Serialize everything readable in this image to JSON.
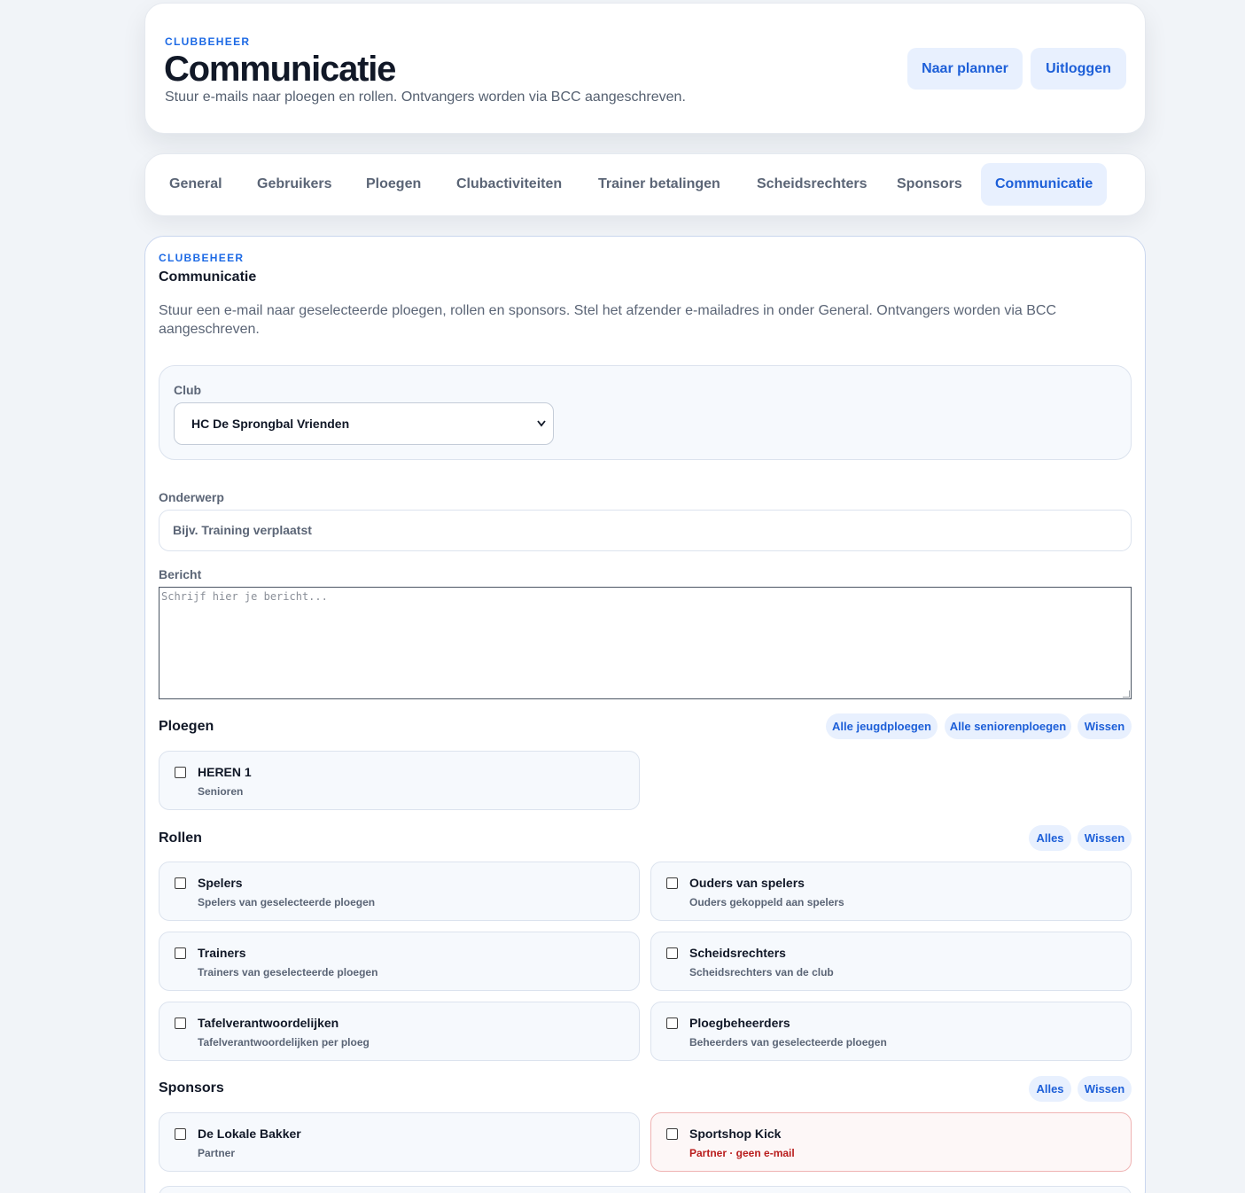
{
  "header": {
    "eyebrow": "CLUBBEHEER",
    "title": "Communicatie",
    "subtitle": "Stuur e-mails naar ploegen en rollen. Ontvangers worden via BCC aangeschreven.",
    "planner_button": "Naar planner",
    "logout_button": "Uitloggen"
  },
  "tabs": [
    {
      "label": "General"
    },
    {
      "label": "Gebruikers"
    },
    {
      "label": "Ploegen"
    },
    {
      "label": "Clubactiviteiten"
    },
    {
      "label": "Trainer betalingen"
    },
    {
      "label": "Scheidsrechters"
    },
    {
      "label": "Sponsors"
    },
    {
      "label": "Communicatie",
      "active": true
    }
  ],
  "main": {
    "eyebrow": "CLUBBEHEER",
    "title": "Communicatie",
    "description": "Stuur een e-mail naar geselecteerde ploegen, rollen en sponsors. Stel het afzender e-mailadres in onder General. Ontvangers worden via BCC aangeschreven.",
    "club": {
      "label": "Club",
      "selected": "HC De Sprongbal Vrienden"
    },
    "subject": {
      "label": "Onderwerp",
      "placeholder": "Bijv. Training verplaatst",
      "value": ""
    },
    "message": {
      "label": "Bericht",
      "placeholder": "Schrijf hier je bericht...",
      "value": ""
    },
    "teams": {
      "title": "Ploegen",
      "buttons": {
        "youth": "Alle jeugdploegen",
        "senior": "Alle seniorenploegen",
        "clear": "Wissen"
      },
      "items": [
        {
          "name": "HEREN 1",
          "sub": "Senioren",
          "checked": false
        }
      ]
    },
    "roles": {
      "title": "Rollen",
      "buttons": {
        "all": "Alles",
        "clear": "Wissen"
      },
      "items": [
        {
          "name": "Spelers",
          "sub": "Spelers van geselecteerde ploegen",
          "checked": false
        },
        {
          "name": "Ouders van spelers",
          "sub": "Ouders gekoppeld aan spelers",
          "checked": false
        },
        {
          "name": "Trainers",
          "sub": "Trainers van geselecteerde ploegen",
          "checked": false
        },
        {
          "name": "Scheidsrechters",
          "sub": "Scheidsrechters van de club",
          "checked": false
        },
        {
          "name": "Tafelverantwoordelijken",
          "sub": "Tafelverantwoordelijken per ploeg",
          "checked": false
        },
        {
          "name": "Ploegbeheerders",
          "sub": "Beheerders van geselecteerde ploegen",
          "checked": false
        }
      ]
    },
    "sponsors": {
      "title": "Sponsors",
      "buttons": {
        "all": "Alles",
        "clear": "Wissen"
      },
      "items": [
        {
          "name": "De Lokale Bakker",
          "sub": "Partner",
          "checked": false
        },
        {
          "name": "Sportshop Kick",
          "sub": "Partner · geen e-mail",
          "checked": false,
          "warning": true
        }
      ]
    }
  },
  "colors": {
    "accent": "#1d5fd8",
    "accent_bg": "#e8f0fe",
    "warning": "#b91c1c",
    "page_bg": "#f1f4f8"
  }
}
